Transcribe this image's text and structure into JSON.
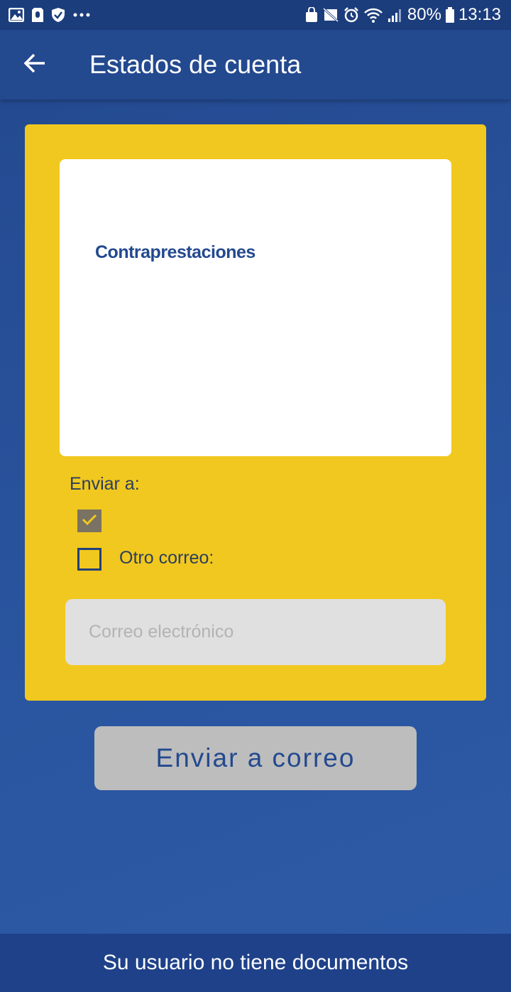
{
  "status_bar": {
    "left_icons": [
      "image-icon",
      "sim-alert-icon",
      "shield-icon",
      "more-dots-icon"
    ],
    "right_icons": [
      "recycle-lock-icon",
      "silent-icon",
      "alarm-icon",
      "wifi-icon",
      "signal-icon",
      "battery-icon"
    ],
    "battery": "80%",
    "time": "13:13"
  },
  "app_bar": {
    "back_icon": "arrow-left-icon",
    "title": "Estados de cuenta"
  },
  "documents": {
    "items": [
      "Contraprestaciones"
    ]
  },
  "send_options": {
    "label": "Enviar a:",
    "primary_checked": true,
    "other_label": "Otro correo:",
    "other_checked": false,
    "email_placeholder": "Correo electrónico",
    "email_value": ""
  },
  "submit": {
    "label": "Enviar a correo"
  },
  "footer": {
    "message": "Su usuario no tiene documentos"
  },
  "colors": {
    "primary_blue": "#23498f",
    "card_yellow": "#f1c81f",
    "button_gray": "#bdbdbd",
    "input_gray": "#e0e0e0"
  }
}
